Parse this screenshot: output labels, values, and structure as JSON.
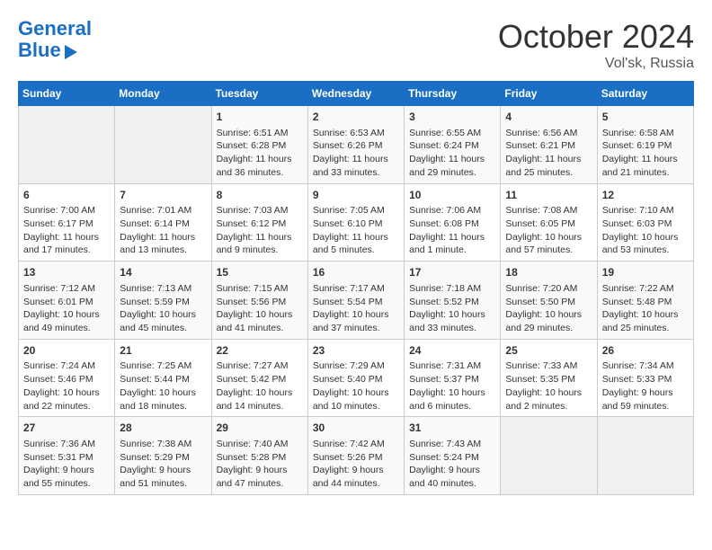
{
  "header": {
    "logo_line1": "General",
    "logo_line2": "Blue",
    "month": "October 2024",
    "location": "Vol'sk, Russia"
  },
  "weekdays": [
    "Sunday",
    "Monday",
    "Tuesday",
    "Wednesday",
    "Thursday",
    "Friday",
    "Saturday"
  ],
  "weeks": [
    [
      {
        "day": "",
        "content": ""
      },
      {
        "day": "",
        "content": ""
      },
      {
        "day": "1",
        "content": "Sunrise: 6:51 AM\nSunset: 6:28 PM\nDaylight: 11 hours and 36 minutes."
      },
      {
        "day": "2",
        "content": "Sunrise: 6:53 AM\nSunset: 6:26 PM\nDaylight: 11 hours and 33 minutes."
      },
      {
        "day": "3",
        "content": "Sunrise: 6:55 AM\nSunset: 6:24 PM\nDaylight: 11 hours and 29 minutes."
      },
      {
        "day": "4",
        "content": "Sunrise: 6:56 AM\nSunset: 6:21 PM\nDaylight: 11 hours and 25 minutes."
      },
      {
        "day": "5",
        "content": "Sunrise: 6:58 AM\nSunset: 6:19 PM\nDaylight: 11 hours and 21 minutes."
      }
    ],
    [
      {
        "day": "6",
        "content": "Sunrise: 7:00 AM\nSunset: 6:17 PM\nDaylight: 11 hours and 17 minutes."
      },
      {
        "day": "7",
        "content": "Sunrise: 7:01 AM\nSunset: 6:14 PM\nDaylight: 11 hours and 13 minutes."
      },
      {
        "day": "8",
        "content": "Sunrise: 7:03 AM\nSunset: 6:12 PM\nDaylight: 11 hours and 9 minutes."
      },
      {
        "day": "9",
        "content": "Sunrise: 7:05 AM\nSunset: 6:10 PM\nDaylight: 11 hours and 5 minutes."
      },
      {
        "day": "10",
        "content": "Sunrise: 7:06 AM\nSunset: 6:08 PM\nDaylight: 11 hours and 1 minute."
      },
      {
        "day": "11",
        "content": "Sunrise: 7:08 AM\nSunset: 6:05 PM\nDaylight: 10 hours and 57 minutes."
      },
      {
        "day": "12",
        "content": "Sunrise: 7:10 AM\nSunset: 6:03 PM\nDaylight: 10 hours and 53 minutes."
      }
    ],
    [
      {
        "day": "13",
        "content": "Sunrise: 7:12 AM\nSunset: 6:01 PM\nDaylight: 10 hours and 49 minutes."
      },
      {
        "day": "14",
        "content": "Sunrise: 7:13 AM\nSunset: 5:59 PM\nDaylight: 10 hours and 45 minutes."
      },
      {
        "day": "15",
        "content": "Sunrise: 7:15 AM\nSunset: 5:56 PM\nDaylight: 10 hours and 41 minutes."
      },
      {
        "day": "16",
        "content": "Sunrise: 7:17 AM\nSunset: 5:54 PM\nDaylight: 10 hours and 37 minutes."
      },
      {
        "day": "17",
        "content": "Sunrise: 7:18 AM\nSunset: 5:52 PM\nDaylight: 10 hours and 33 minutes."
      },
      {
        "day": "18",
        "content": "Sunrise: 7:20 AM\nSunset: 5:50 PM\nDaylight: 10 hours and 29 minutes."
      },
      {
        "day": "19",
        "content": "Sunrise: 7:22 AM\nSunset: 5:48 PM\nDaylight: 10 hours and 25 minutes."
      }
    ],
    [
      {
        "day": "20",
        "content": "Sunrise: 7:24 AM\nSunset: 5:46 PM\nDaylight: 10 hours and 22 minutes."
      },
      {
        "day": "21",
        "content": "Sunrise: 7:25 AM\nSunset: 5:44 PM\nDaylight: 10 hours and 18 minutes."
      },
      {
        "day": "22",
        "content": "Sunrise: 7:27 AM\nSunset: 5:42 PM\nDaylight: 10 hours and 14 minutes."
      },
      {
        "day": "23",
        "content": "Sunrise: 7:29 AM\nSunset: 5:40 PM\nDaylight: 10 hours and 10 minutes."
      },
      {
        "day": "24",
        "content": "Sunrise: 7:31 AM\nSunset: 5:37 PM\nDaylight: 10 hours and 6 minutes."
      },
      {
        "day": "25",
        "content": "Sunrise: 7:33 AM\nSunset: 5:35 PM\nDaylight: 10 hours and 2 minutes."
      },
      {
        "day": "26",
        "content": "Sunrise: 7:34 AM\nSunset: 5:33 PM\nDaylight: 9 hours and 59 minutes."
      }
    ],
    [
      {
        "day": "27",
        "content": "Sunrise: 7:36 AM\nSunset: 5:31 PM\nDaylight: 9 hours and 55 minutes."
      },
      {
        "day": "28",
        "content": "Sunrise: 7:38 AM\nSunset: 5:29 PM\nDaylight: 9 hours and 51 minutes."
      },
      {
        "day": "29",
        "content": "Sunrise: 7:40 AM\nSunset: 5:28 PM\nDaylight: 9 hours and 47 minutes."
      },
      {
        "day": "30",
        "content": "Sunrise: 7:42 AM\nSunset: 5:26 PM\nDaylight: 9 hours and 44 minutes."
      },
      {
        "day": "31",
        "content": "Sunrise: 7:43 AM\nSunset: 5:24 PM\nDaylight: 9 hours and 40 minutes."
      },
      {
        "day": "",
        "content": ""
      },
      {
        "day": "",
        "content": ""
      }
    ]
  ]
}
